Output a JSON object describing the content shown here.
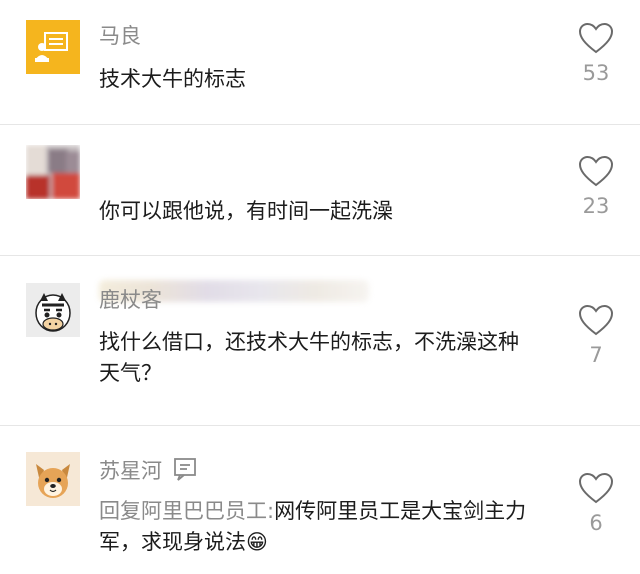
{
  "comments": [
    {
      "name": "马良",
      "text": "技术大牛的标志",
      "likes": "53",
      "avatar_icon": "presenter-board-icon",
      "avatar_color": "#F5B51E"
    },
    {
      "name": "",
      "text": "你可以跟他说，有时间一起洗澡",
      "likes": "23",
      "avatar_icon": "blurred-photo-avatar"
    },
    {
      "name": "鹿杖客",
      "text": "找什么借口，还技术大牛的标志，不洗澡这种天气？",
      "likes": "7",
      "avatar_icon": "zebra-avatar"
    },
    {
      "name": "苏星河",
      "reply_prefix": "回复阿里巴巴员工:",
      "text": "网传阿里员工是大宝剑主力军，求现身说法😁",
      "likes": "6",
      "avatar_icon": "dog-avatar",
      "badge_icon": "reply-message-icon"
    }
  ],
  "colors": {
    "accent": "#F5B51E",
    "name_gray": "#8A8A8A",
    "text": "#1C1C1C",
    "divider": "#E6E6E6"
  }
}
